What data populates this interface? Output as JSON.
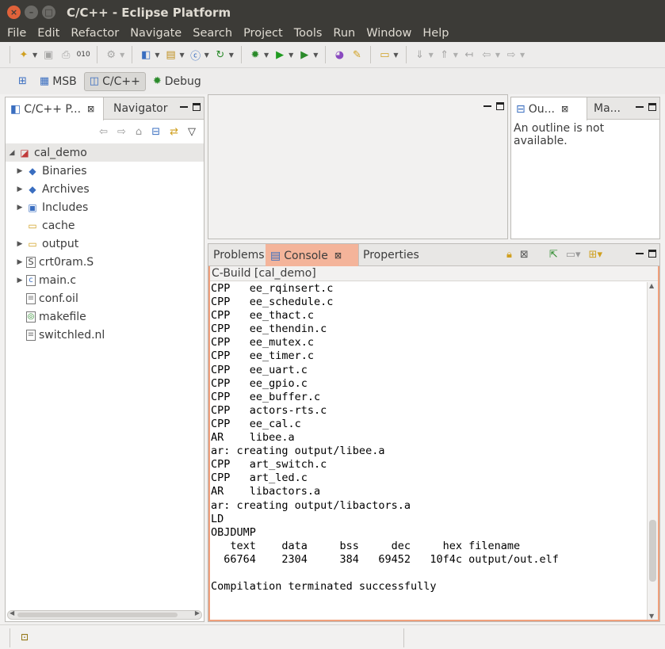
{
  "window": {
    "title": "C/C++ - Eclipse Platform",
    "controls": {
      "close": "×",
      "minimize": "–",
      "maximize": "□"
    }
  },
  "menu": [
    "File",
    "Edit",
    "Refactor",
    "Navigate",
    "Search",
    "Project",
    "Tools",
    "Run",
    "Window",
    "Help"
  ],
  "perspectives": [
    {
      "label": "MSB",
      "icon": "table-icon",
      "active": false
    },
    {
      "label": "C/C++",
      "icon": "c-perspective-icon",
      "active": true
    },
    {
      "label": "Debug",
      "icon": "bug-icon",
      "active": false
    }
  ],
  "project_explorer": {
    "tabs": [
      {
        "label": "C/C++ P...",
        "selected": true
      },
      {
        "label": "Navigator",
        "selected": false
      }
    ],
    "root": {
      "label": "cal_demo",
      "expanded": true
    },
    "items": [
      {
        "label": "Binaries",
        "icon": "binaries-icon",
        "expandable": true
      },
      {
        "label": "Archives",
        "icon": "archives-icon",
        "expandable": true
      },
      {
        "label": "Includes",
        "icon": "includes-icon",
        "expandable": true
      },
      {
        "label": "cache",
        "icon": "folder-icon",
        "expandable": false
      },
      {
        "label": "output",
        "icon": "folder-icon",
        "expandable": true
      },
      {
        "label": "crt0ram.S",
        "icon": "asm-file-icon",
        "expandable": true
      },
      {
        "label": "main.c",
        "icon": "c-file-icon",
        "expandable": true
      },
      {
        "label": "conf.oil",
        "icon": "file-icon",
        "expandable": false
      },
      {
        "label": "makefile",
        "icon": "makefile-icon",
        "expandable": false
      },
      {
        "label": "switchled.nl",
        "icon": "file-icon",
        "expandable": false
      }
    ]
  },
  "outline": {
    "tabs": [
      {
        "label": "Ou...",
        "selected": true
      },
      {
        "label": "Ma...",
        "selected": false
      }
    ],
    "message": "An outline is not available."
  },
  "bottom": {
    "tabs": [
      {
        "label": "Problems",
        "selected": false
      },
      {
        "label": "Console",
        "selected": true
      },
      {
        "label": "Properties",
        "selected": false
      }
    ],
    "console_title": "C-Build [cal_demo]",
    "lines": [
      "CPP   ee_rqinsert.c",
      "CPP   ee_schedule.c",
      "CPP   ee_thact.c",
      "CPP   ee_thendin.c",
      "CPP   ee_mutex.c",
      "CPP   ee_timer.c",
      "CPP   ee_uart.c",
      "CPP   ee_gpio.c",
      "CPP   ee_buffer.c",
      "CPP   actors-rts.c",
      "CPP   ee_cal.c",
      "AR    libee.a",
      "ar: creating output/libee.a",
      "CPP   art_switch.c",
      "CPP   art_led.c",
      "AR    libactors.a",
      "ar: creating output/libactors.a",
      "LD",
      "OBJDUMP",
      "   text    data     bss     dec     hex filename",
      "  66764    2304     384   69452   10f4c output/out.elf",
      "",
      "Compilation terminated successfully"
    ]
  },
  "colors": {
    "titlebar": "#3c3b37",
    "close_button": "#e0623a",
    "console_tab_active": "#f4b49a",
    "console_border": "#f0a07c"
  }
}
